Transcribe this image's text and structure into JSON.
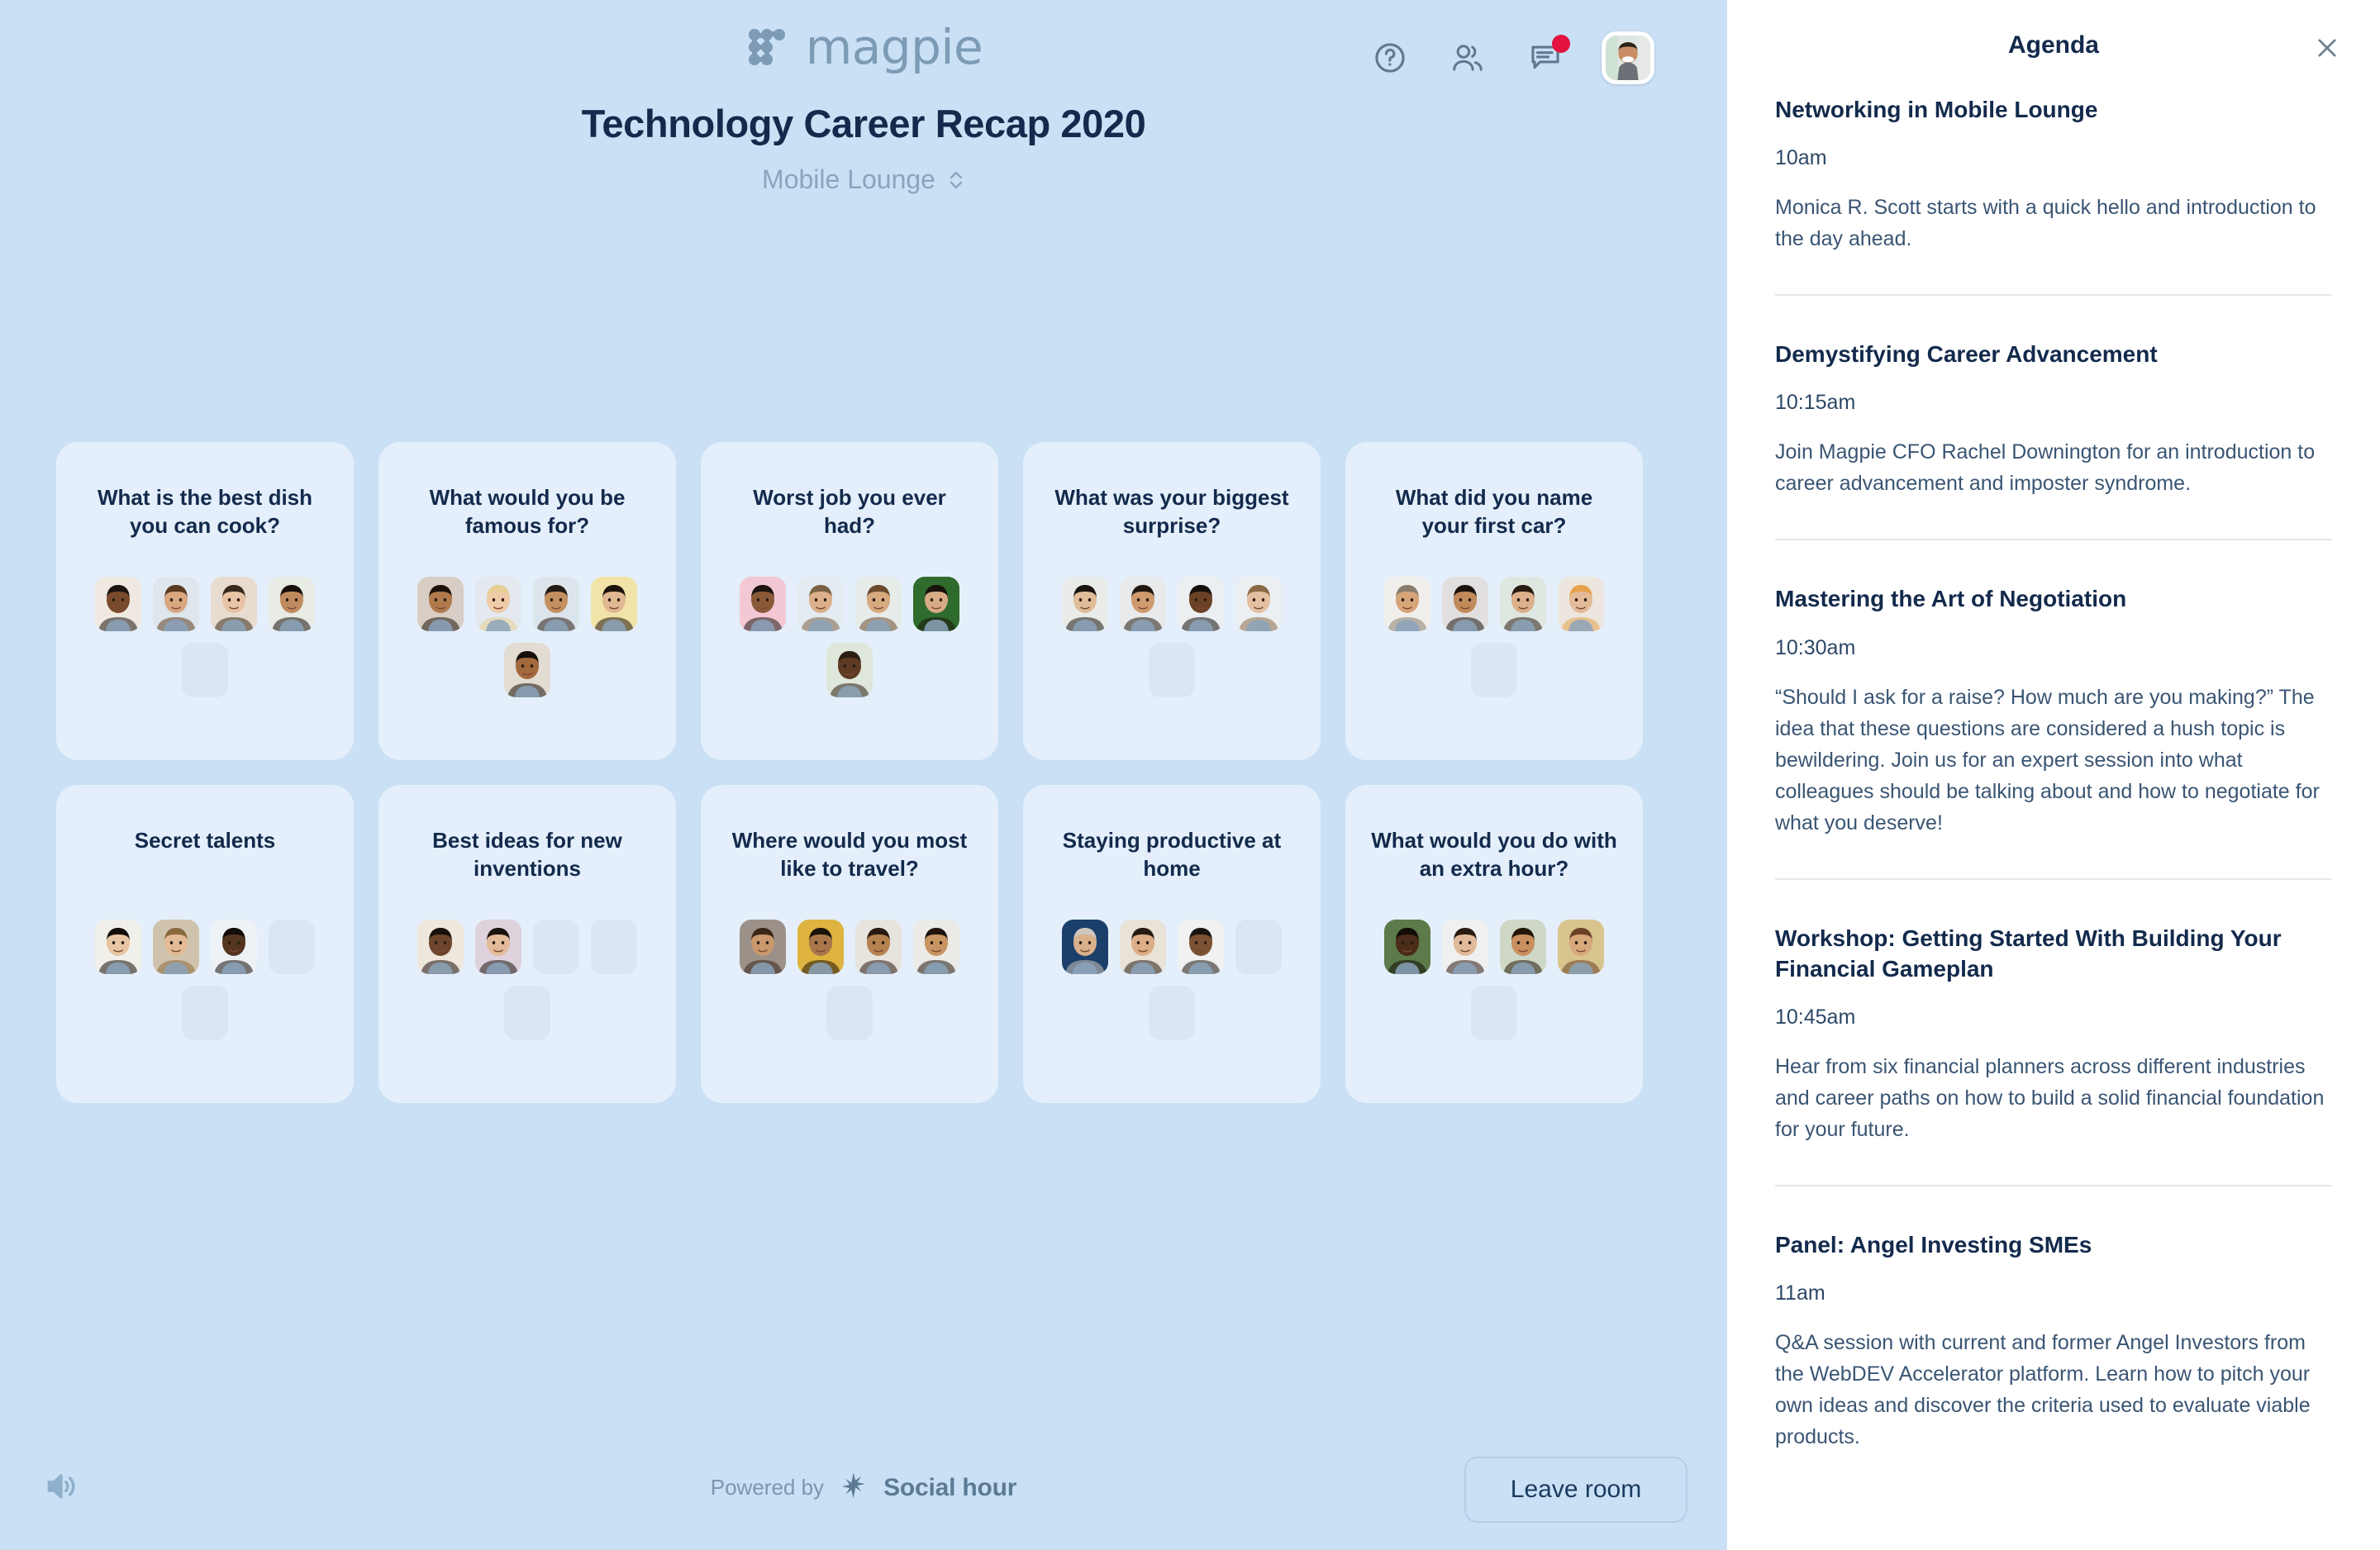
{
  "brand": {
    "name": "magpie",
    "logo_icon": "magpie-nodes-logo"
  },
  "header": {
    "icons": [
      {
        "name": "help-icon",
        "label": "Help"
      },
      {
        "name": "people-icon",
        "label": "Participants"
      },
      {
        "name": "chat-icon",
        "label": "Chat",
        "has_notification": true
      }
    ],
    "avatar_name": "user-avatar"
  },
  "event": {
    "title": "Technology Career Recap 2020",
    "room": "Mobile Lounge",
    "room_caret_icon": "chevron-up-down-icon"
  },
  "cards": [
    {
      "title": "What is the best dish you can cook?",
      "seats": [
        "f1",
        "f2",
        "f3",
        "f4",
        "empty"
      ]
    },
    {
      "title": "What would you be famous for?",
      "seats": [
        "m1",
        "f5",
        "f6",
        "m2",
        "m3"
      ]
    },
    {
      "title": "Worst job you ever had?",
      "seats": [
        "f7",
        "m4",
        "f8",
        "m5",
        "f9"
      ]
    },
    {
      "title": "What was your biggest surprise?",
      "seats": [
        "m6",
        "m7",
        "f10",
        "m8",
        "empty"
      ]
    },
    {
      "title": "What did you name your first car?",
      "seats": [
        "f11",
        "m9",
        "f12",
        "f13",
        "empty"
      ]
    },
    {
      "title": "Secret talents",
      "seats": [
        "m10",
        "m11",
        "m12",
        "empty",
        "empty"
      ]
    },
    {
      "title": "Best ideas for new inventions",
      "seats": [
        "f14",
        "m13",
        "empty",
        "empty",
        "empty"
      ]
    },
    {
      "title": "Where would you most like to travel?",
      "seats": [
        "f15",
        "f16",
        "m14",
        "m15",
        "empty"
      ]
    },
    {
      "title": "Staying productive at home",
      "seats": [
        "f17",
        "f18",
        "f19",
        "empty",
        "empty"
      ]
    },
    {
      "title": "What would you do with an extra hour?",
      "seats": [
        "m16",
        "f20",
        "m17",
        "f21",
        "empty"
      ]
    }
  ],
  "footer": {
    "sound_icon": "speaker-icon",
    "powered_by_label": "Powered by",
    "social_hour_icon": "social-hour-star-icon",
    "social_hour_label": "Social hour",
    "leave_label": "Leave room"
  },
  "agenda": {
    "title": "Agenda",
    "close_icon": "close-icon",
    "items": [
      {
        "title": "Networking in Mobile Lounge",
        "time": "10am",
        "description": "Monica R. Scott starts with a quick hello and introduction to the day ahead."
      },
      {
        "title": "Demystifying Career Advancement",
        "time": "10:15am",
        "description": "Join Magpie CFO Rachel Downington for an introduction to career advancement and imposter syndrome."
      },
      {
        "title": "Mastering the Art of Negotiation",
        "time": "10:30am",
        "description": "“Should I ask for a raise? How much are you making?” The idea that these questions are considered a hush topic is bewildering. Join us for an expert session into what colleagues should be talking about and how to negotiate for what you deserve!"
      },
      {
        "title": "Workshop: Getting Started With Building Your Financial Gameplan",
        "time": "10:45am",
        "description": "Hear from six financial planners across different industries and career paths on how to build a solid financial foundation for your future."
      },
      {
        "title": "Panel: Angel Investing SMEs",
        "time": "11am",
        "description": "Q&A session with current and former Angel Investors from the WebDEV Accelerator platform. Learn how to pitch your own ideas and discover the criteria used to evaluate viable products."
      }
    ]
  },
  "colors": {
    "page_bg": "#c9e0f5",
    "card_bg": "#e4effb",
    "title_navy": "#132a4c",
    "muted_blue": "#8aa5bd",
    "notification_red": "#e3123f",
    "panel_bg": "#ffffff"
  }
}
